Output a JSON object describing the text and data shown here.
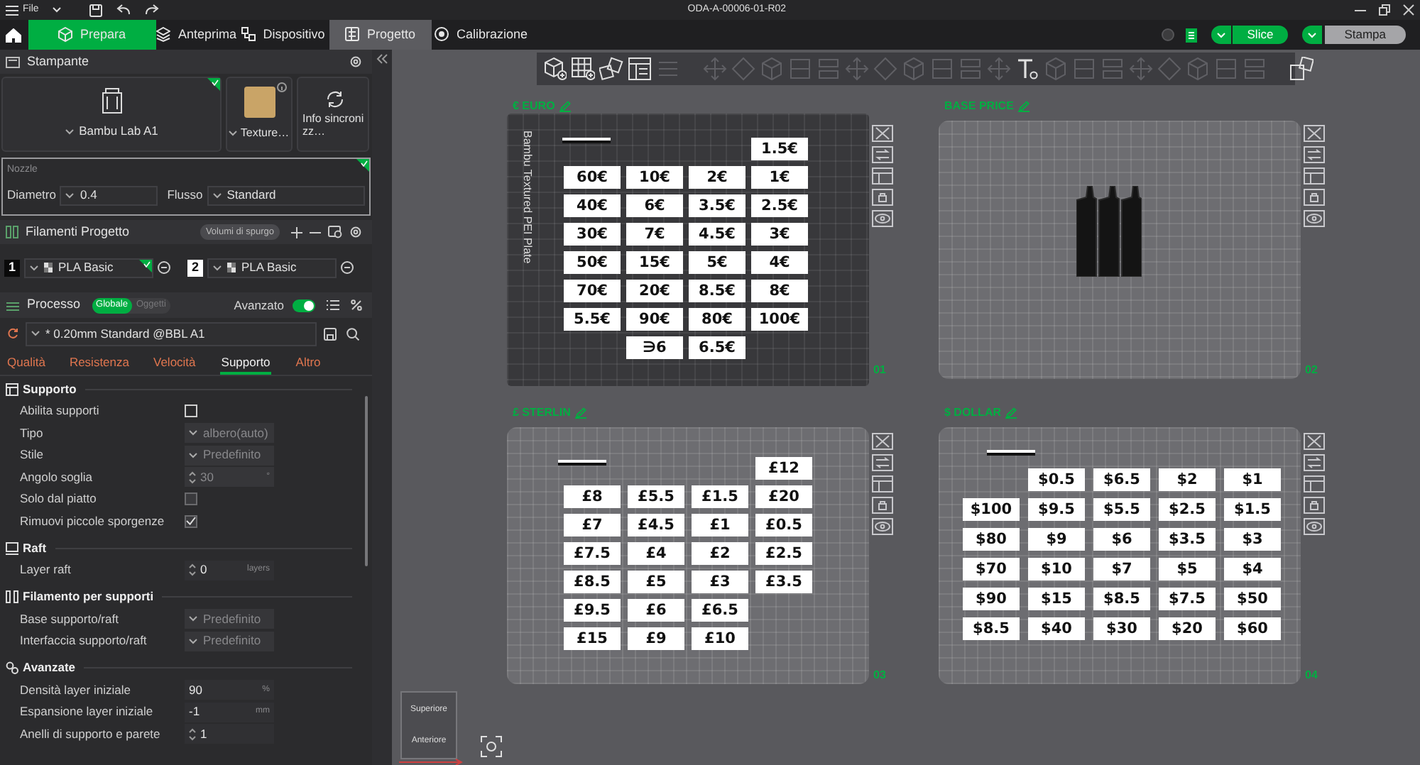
{
  "title_bar": {
    "menu": "File",
    "title": "ODA-A-00006-01-R02"
  },
  "tabs": [
    {
      "label": "Prepara",
      "selected": true,
      "hovered": false
    },
    {
      "label": "Anteprima",
      "selected": false,
      "hovered": false
    },
    {
      "label": "Dispositivo",
      "selected": false,
      "hovered": false
    },
    {
      "label": "Progetto",
      "selected": false,
      "hovered": true
    },
    {
      "label": "Calibrazione",
      "selected": false,
      "hovered": false
    }
  ],
  "actions": [
    {
      "label": "Slice",
      "kind": "primary"
    },
    {
      "label": "Stampa",
      "kind": "secondary"
    }
  ],
  "printer": {
    "heading": "Stampante",
    "printer": "Bambu Lab A1",
    "plate_type": "Texture…",
    "sync": "Info sincronizz…"
  },
  "nozzle": {
    "heading": "Nozzle",
    "diameter_label": "Diametro",
    "diameter": "0.4",
    "flow_label": "Flusso",
    "flow": "Standard"
  },
  "filaments": {
    "heading": "Filamenti Progetto",
    "flush_button": "Volumi di spurgo",
    "items": [
      {
        "number": "1",
        "name": "PLA Basic",
        "color": "#0a0a0a"
      },
      {
        "number": "2",
        "name": "PLA Basic",
        "color": "#ffffff"
      }
    ]
  },
  "process": {
    "heading": "Processo",
    "scope": [
      {
        "label": "Globale",
        "selected": true
      },
      {
        "label": "Oggetti",
        "selected": false
      }
    ],
    "advanced_label": "Avanzato",
    "advanced": true,
    "preset": "* 0.20mm Standard @BBL A1",
    "tabs": [
      {
        "label": "Qualità",
        "selected": false
      },
      {
        "label": "Resistenza",
        "selected": false
      },
      {
        "label": "Velocità",
        "selected": false
      },
      {
        "label": "Supporto",
        "selected": true
      },
      {
        "label": "Altro",
        "selected": false
      }
    ]
  },
  "sections": [
    {
      "title": "Supporto",
      "items": [
        {
          "label": "Abilita supporti",
          "kind": "checkbox",
          "checked": false,
          "disabled": false
        },
        {
          "label": "Tipo",
          "kind": "select",
          "value": "albero(auto)",
          "disabled": true
        },
        {
          "label": "Stile",
          "kind": "select",
          "value": "Predefinito",
          "disabled": true
        },
        {
          "label": "Angolo soglia",
          "kind": "spinner",
          "value": "30",
          "unit": "°",
          "disabled": true
        },
        {
          "label": "Solo dal piatto",
          "kind": "checkbox",
          "checked": false,
          "disabled": true
        },
        {
          "label": "Rimuovi piccole sporgenze",
          "kind": "checkbox",
          "checked": true,
          "disabled": true
        }
      ]
    },
    {
      "title": "Raft",
      "items": [
        {
          "label": "Layer raft",
          "kind": "spinner",
          "value": "0",
          "unit": "layers",
          "disabled": false
        }
      ]
    },
    {
      "title": "Filamento per supporti",
      "items": [
        {
          "label": "Base supporto/raft",
          "kind": "select",
          "value": "Predefinito",
          "disabled": true
        },
        {
          "label": "Interfaccia supporto/raft",
          "kind": "select",
          "value": "Predefinito",
          "disabled": true
        }
      ]
    },
    {
      "title": "Avanzate",
      "items": [
        {
          "label": "Densità layer iniziale",
          "kind": "input",
          "value": "90",
          "unit": "%",
          "disabled": false
        },
        {
          "label": "Espansione layer iniziale",
          "kind": "input",
          "value": "-1",
          "unit": "mm",
          "disabled": false
        },
        {
          "label": "Anelli di supporto e parete",
          "kind": "spinner",
          "value": "1",
          "disabled": false
        }
      ]
    }
  ],
  "plates": [
    {
      "name": "€ EURO",
      "number": "01",
      "kind": "textured",
      "plate_label": "Bambu Textured PEI Plate",
      "rows": [
        [
          null,
          null,
          null,
          "1.5€"
        ],
        [
          "60€",
          "10€",
          "2€",
          "1€"
        ],
        [
          "40€",
          "6€",
          "3.5€",
          "2.5€"
        ],
        [
          "30€",
          "7€",
          "4.5€",
          "3€"
        ],
        [
          "50€",
          "15€",
          "5€",
          "4€"
        ],
        [
          "70€",
          "20€",
          "8.5€",
          "8€"
        ],
        [
          "5.5€",
          "90€",
          "80€",
          "100€"
        ],
        [
          null,
          "∋6",
          "6.5€",
          null
        ]
      ]
    },
    {
      "name": "BASE PRICE",
      "number": "02",
      "kind": "smooth"
    },
    {
      "name": "£ STERLIN",
      "number": "03",
      "kind": "smooth",
      "rows": [
        [
          null,
          null,
          null,
          "£12"
        ],
        [
          "£8",
          "£5.5",
          "£1.5",
          "£20"
        ],
        [
          "£7",
          "£4.5",
          "£1",
          "£0.5"
        ],
        [
          "£7.5",
          "£4",
          "£2",
          "£2.5"
        ],
        [
          "£8.5",
          "£5",
          "£3",
          "£3.5"
        ],
        [
          "£9.5",
          "£6",
          "£6.5",
          null
        ],
        [
          "£15",
          "£9",
          "£10",
          null
        ]
      ]
    },
    {
      "name": "$ DOLLAR",
      "number": "04",
      "kind": "smooth",
      "rows": [
        [
          null,
          "$0.5",
          "$6.5",
          "$2",
          "$1"
        ],
        [
          "$100",
          "$9.5",
          "$5.5",
          "$2.5",
          "$1.5"
        ],
        [
          "$80",
          "$9",
          "$6",
          "$3.5",
          "$3"
        ],
        [
          "$70",
          "$10",
          "$7",
          "$5",
          "$4"
        ],
        [
          "$90",
          "$15",
          "$8.5",
          "$7.5",
          "$50"
        ],
        [
          "$8.5",
          "$40",
          "$30",
          "$20",
          "$60"
        ]
      ]
    }
  ],
  "view_cube": {
    "top": "Superiore",
    "front": "Anteriore"
  }
}
